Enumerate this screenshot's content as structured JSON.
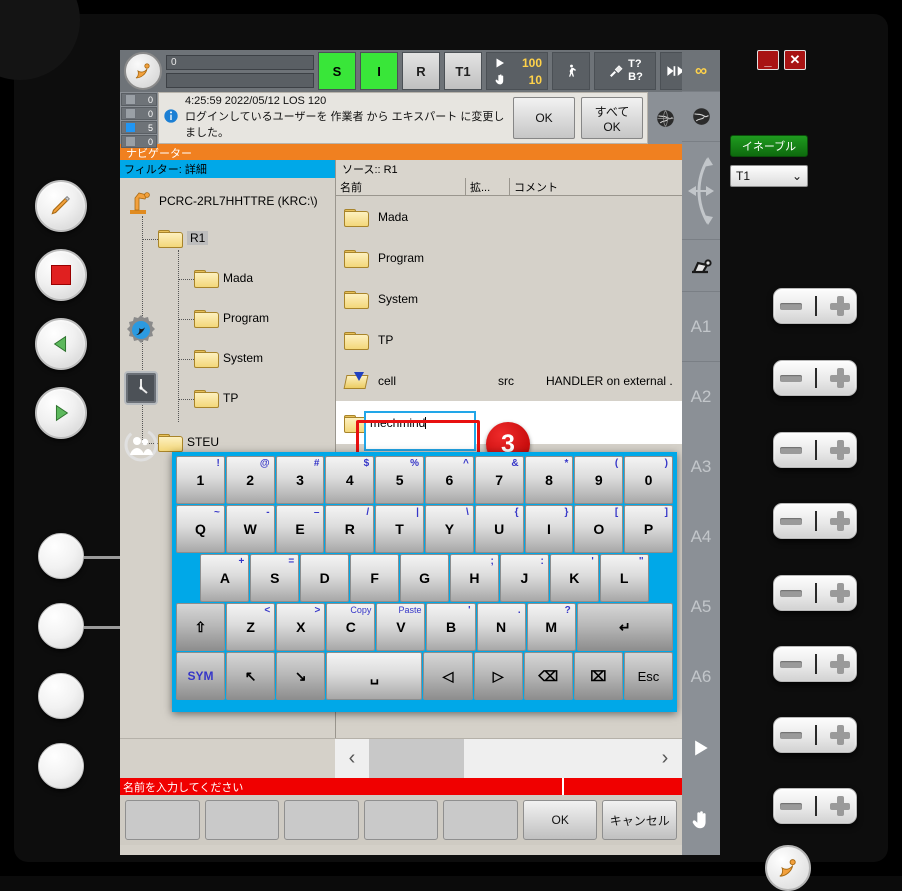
{
  "window": {
    "minimize": "_",
    "close": "✕"
  },
  "topbar": {
    "logo_icon": "kuka-robot-icon",
    "field1_value": "0",
    "field2_value": "",
    "indicators": [
      {
        "label": "S",
        "state": "green"
      },
      {
        "label": "I",
        "state": "green"
      },
      {
        "label": "R",
        "state": "grey"
      },
      {
        "label": "T1",
        "state": "grey"
      }
    ],
    "override": {
      "program_icon": "play-icon",
      "program_value": "100",
      "jog_icon": "hand-icon",
      "jog_value": "10"
    },
    "buttons": [
      {
        "name": "walk-figure",
        "text": ""
      },
      {
        "name": "tool-base",
        "line1": "T?",
        "line2": "B?"
      },
      {
        "name": "increment",
        "text": "∞"
      }
    ]
  },
  "message": {
    "counters": [
      {
        "icon": "ack-message-icon",
        "count": "0",
        "active": false
      },
      {
        "icon": "warning-message-icon",
        "count": "0",
        "active": false
      },
      {
        "icon": "info-message-icon",
        "count": "5",
        "active": true
      },
      {
        "icon": "wait-message-icon",
        "count": "0",
        "active": false
      }
    ],
    "icon": "info-icon",
    "line1": "4:25:59 2022/05/12 LOS 120",
    "line2": "ログインしているユーザーを 作業者 から エキスパート に変更しました。",
    "ok_label": "OK",
    "ok_all_label": "すべてOK",
    "globe_icon": "globe-icon"
  },
  "navigator": {
    "title": "ナビゲーター",
    "filter_label": "フィルター: 詳細",
    "source_label": "ソース:: R1",
    "tree": {
      "root": {
        "icon": "robot-icon",
        "label": "PCRC-2RL7HHTTRE (KRC:\\)"
      },
      "nodes": [
        {
          "label": "R1",
          "level": 1,
          "selected": true,
          "icon": "folder-icon"
        },
        {
          "label": "Mada",
          "level": 2,
          "selected": false,
          "icon": "folder-icon"
        },
        {
          "label": "Program",
          "level": 2,
          "selected": false,
          "icon": "folder-icon"
        },
        {
          "label": "System",
          "level": 2,
          "selected": false,
          "icon": "folder-icon"
        },
        {
          "label": "TP",
          "level": 2,
          "selected": false,
          "icon": "folder-icon"
        },
        {
          "label": "STEU",
          "level": 1,
          "selected": false,
          "icon": "folder-icon"
        }
      ]
    },
    "columns": {
      "name": "名前",
      "ext": "拡...",
      "comment": "コメント"
    },
    "files": [
      {
        "icon": "folder-icon",
        "name": "Mada",
        "ext": "",
        "comment": ""
      },
      {
        "icon": "folder-icon",
        "name": "Program",
        "ext": "",
        "comment": ""
      },
      {
        "icon": "folder-icon",
        "name": "System",
        "ext": "",
        "comment": ""
      },
      {
        "icon": "folder-icon",
        "name": "TP",
        "ext": "",
        "comment": ""
      },
      {
        "icon": "src-file-icon",
        "name": "cell",
        "ext": "src",
        "comment": "HANDLER on external ."
      }
    ],
    "new_folder": {
      "icon": "folder-icon",
      "input_value": "mechmind"
    },
    "annotation_number": "3",
    "scroll": {
      "left_icon": "chevron-left-icon",
      "right_icon": "chevron-right-icon"
    }
  },
  "status_bar": {
    "message": "名前を入力してください"
  },
  "softkeys": [
    {
      "label": "",
      "active": false
    },
    {
      "label": "",
      "active": false
    },
    {
      "label": "",
      "active": false
    },
    {
      "label": "",
      "active": false
    },
    {
      "label": "",
      "active": false
    },
    {
      "label": "OK",
      "active": true
    },
    {
      "label": "キャンセル",
      "active": true
    }
  ],
  "keyboard": {
    "rows": [
      [
        {
          "main": "1",
          "alt": "!"
        },
        {
          "main": "2",
          "alt": "@"
        },
        {
          "main": "3",
          "alt": "#"
        },
        {
          "main": "4",
          "alt": "$"
        },
        {
          "main": "5",
          "alt": "%"
        },
        {
          "main": "6",
          "alt": "^"
        },
        {
          "main": "7",
          "alt": "&"
        },
        {
          "main": "8",
          "alt": "*"
        },
        {
          "main": "9",
          "alt": "("
        },
        {
          "main": "0",
          "alt": ")"
        }
      ],
      [
        {
          "main": "Q",
          "alt": "~"
        },
        {
          "main": "W",
          "alt": "-"
        },
        {
          "main": "E",
          "alt": "–"
        },
        {
          "main": "R",
          "alt": "/"
        },
        {
          "main": "T",
          "alt": "|"
        },
        {
          "main": "Y",
          "alt": "\\"
        },
        {
          "main": "U",
          "alt": "{"
        },
        {
          "main": "I",
          "alt": "}"
        },
        {
          "main": "O",
          "alt": "["
        },
        {
          "main": "P",
          "alt": "]"
        }
      ],
      [
        {
          "main": "A",
          "alt": "+"
        },
        {
          "main": "S",
          "alt": "="
        },
        {
          "main": "D",
          "alt": ""
        },
        {
          "main": "F",
          "alt": ""
        },
        {
          "main": "G",
          "alt": ""
        },
        {
          "main": "H",
          "alt": ";"
        },
        {
          "main": "J",
          "alt": ":"
        },
        {
          "main": "K",
          "alt": "'"
        },
        {
          "main": "L",
          "alt": "\""
        }
      ],
      [
        {
          "main": "⇧",
          "alt": "",
          "name": "shift-key",
          "dark": true
        },
        {
          "main": "Z",
          "alt": "<"
        },
        {
          "main": "X",
          "alt": ">"
        },
        {
          "main": "C",
          "altw": "Copy"
        },
        {
          "main": "V",
          "altw": "Paste"
        },
        {
          "main": "B",
          "alt": "'"
        },
        {
          "main": "N",
          "alt": "."
        },
        {
          "main": "M",
          "alt": "?"
        },
        {
          "main": "↵",
          "alt": "",
          "name": "enter-key",
          "dark": true
        }
      ],
      [
        {
          "main": "SYM",
          "alt": "",
          "name": "sym-key",
          "sym": true,
          "dark": true
        },
        {
          "main": "↖",
          "alt": "",
          "name": "home-key",
          "dark": true
        },
        {
          "main": "↘",
          "alt": "",
          "name": "end-key",
          "dark": true
        },
        {
          "main": "␣",
          "alt": "",
          "name": "space-key"
        },
        {
          "main": "◁",
          "alt": "",
          "name": "cursor-left-key",
          "dark": true
        },
        {
          "main": "▷",
          "alt": "",
          "name": "cursor-right-key",
          "dark": true
        },
        {
          "main": "⌫",
          "alt": "",
          "name": "backspace-key",
          "dark": true
        },
        {
          "main": "⌧",
          "alt": "",
          "name": "delete-key",
          "dark": true
        },
        {
          "main": "Esc",
          "alt": "",
          "name": "escape-key",
          "esc": true,
          "dark": true
        }
      ]
    ]
  },
  "right_panel": {
    "enable_label": "イネーブル",
    "mode_value": "T1",
    "mode_caret": "⌄",
    "strip_icons": [
      {
        "name": "increment-icon",
        "glyph": "∞"
      },
      {
        "name": "globe-icon",
        "glyph": ""
      },
      {
        "name": "jog-direction-icon",
        "glyph": ""
      },
      {
        "name": "coord-system-icon",
        "glyph": ""
      }
    ],
    "axis_labels": [
      "A1",
      "A2",
      "A3",
      "A4",
      "A5",
      "A6"
    ],
    "override_rockers": [
      {
        "name": "program-override-rocker",
        "icon": "play-icon"
      },
      {
        "name": "jog-override-rocker",
        "icon": "hand-icon"
      }
    ],
    "rocker_minus": "−",
    "rocker_plus": "+"
  },
  "hardware_buttons": [
    {
      "name": "edit-button",
      "icon": "pencil-icon"
    },
    {
      "name": "stop-button",
      "icon": "stop-square-icon"
    },
    {
      "name": "back-button",
      "icon": "triangle-left-icon"
    },
    {
      "name": "start-button",
      "icon": "triangle-right-icon"
    }
  ],
  "left_strip_icons": [
    {
      "name": "settings-robot-icon"
    },
    {
      "name": "clock-icon"
    },
    {
      "name": "user-icon"
    }
  ],
  "colors": {
    "accent_blue": "#00a8e8",
    "nav_orange": "#f08020",
    "status_red": "#f00000",
    "enable_green": "#1f9a1f",
    "indicator_green": "#39e639",
    "annotation_red": "#e81010"
  }
}
